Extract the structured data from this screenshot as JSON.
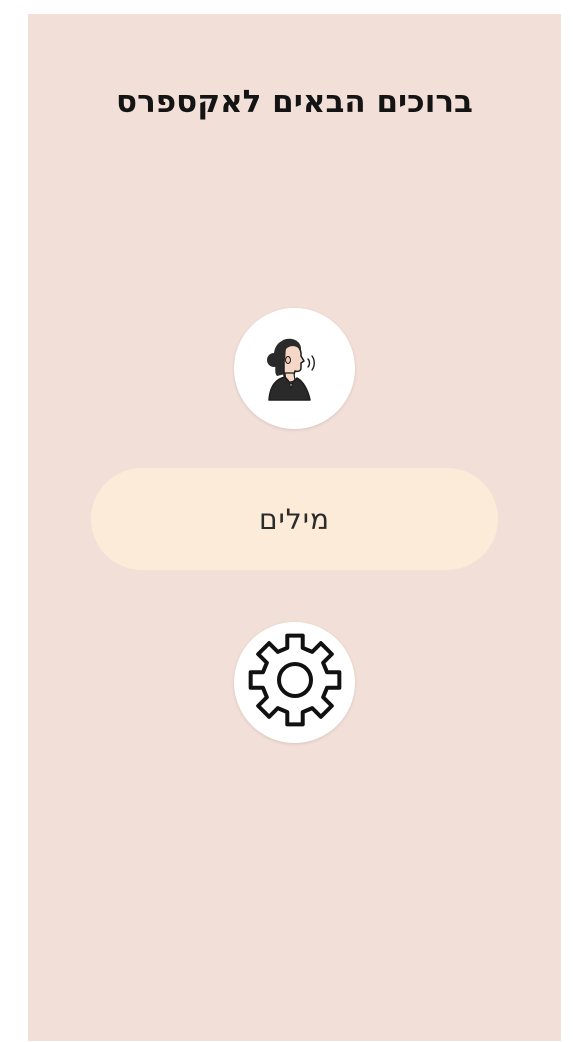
{
  "header": {
    "title": "ברוכים הבאים לאקספרס"
  },
  "main": {
    "speaker_icon": "person-speaking-icon",
    "words_button_label": "מילים",
    "settings_icon": "gear-icon"
  },
  "colors": {
    "background": "#f2e0d8",
    "words_button": "#fcebd8",
    "circle_button": "#ffffff"
  }
}
